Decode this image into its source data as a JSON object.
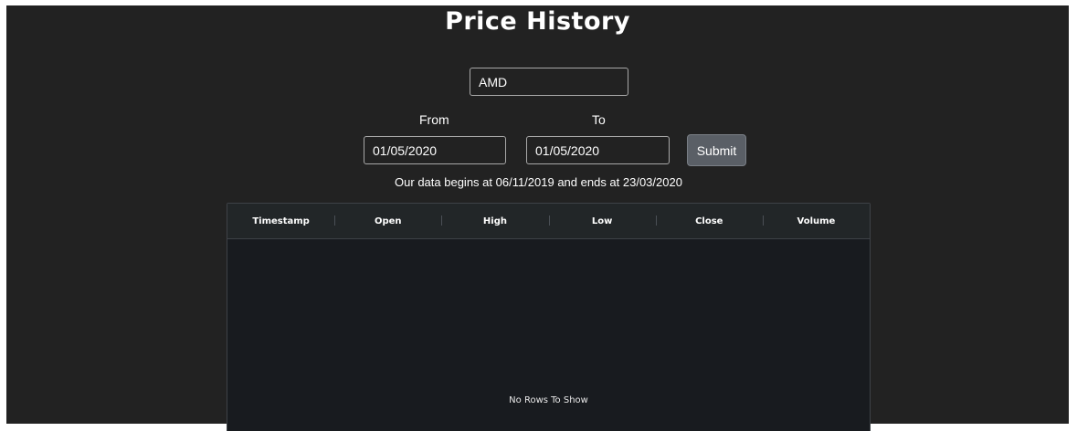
{
  "page": {
    "title": "Price History"
  },
  "form": {
    "symbol_value": "AMD",
    "from_label": "From",
    "from_value": "01/05/2020",
    "to_label": "To",
    "to_value": "01/05/2020",
    "submit_label": "Submit"
  },
  "info_text": "Our data begins at 06/11/2019 and ends at 23/03/2020",
  "grid": {
    "columns": [
      "Timestamp",
      "Open",
      "High",
      "Low",
      "Close",
      "Volume"
    ],
    "empty_message": "No Rows To Show"
  },
  "colors": {
    "background": "#222222",
    "grid_background": "#181b1f",
    "button": "#5a5f66"
  }
}
